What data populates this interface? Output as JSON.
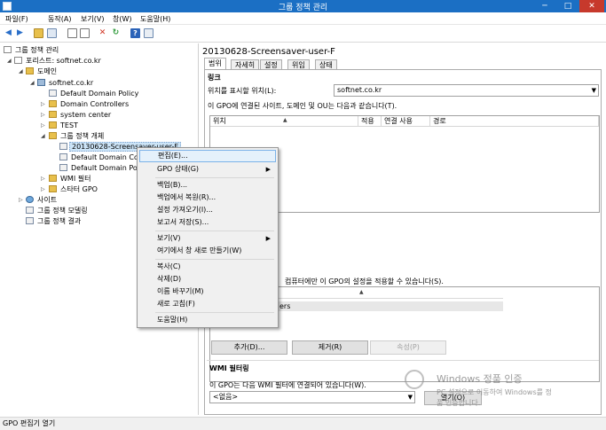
{
  "window": {
    "title": "그룹 정책 관리",
    "minimize": "─",
    "maximize": "□",
    "close": "✕"
  },
  "menu": [
    "파일(F)",
    "동작(A)",
    "보기(V)",
    "창(W)",
    "도움말(H)"
  ],
  "toolbar": {
    "icons": [
      "back-icon",
      "forward-icon",
      "up-icon",
      "show-tree-icon",
      "copy-icon",
      "paste-icon",
      "delete-icon",
      "refresh-icon",
      "help-icon",
      "properties-icon"
    ]
  },
  "tree": {
    "root": "그룹 정책 관리",
    "forest": "포리스트: softnet.co.kr",
    "domains": "도메인",
    "domain": "softnet.co.kr",
    "ddp": "Default Domain Policy",
    "dc": "Domain Controllers",
    "system_center": "system center",
    "test": "TEST",
    "gpo_objects": "그룹 정책 개체",
    "gpo_selected": "20130628-Screensaver-user-F",
    "gpo_dc": "Default Domain Con",
    "gpo_dp": "Default Domain Poli",
    "wmi": "WMI 필터",
    "starter": "스타터 GPO",
    "sites": "사이트",
    "modeling": "그룹 정책 모델링",
    "results": "그룹 정책 결과"
  },
  "right": {
    "title": "20130628-Screensaver-user-F",
    "tabs": [
      "범위",
      "자세히",
      "설정",
      "위임",
      "상태"
    ],
    "links_heading": "링크",
    "links_label": "위치를 표시할 위치(L):",
    "links_value": "softnet.co.kr",
    "links_desc": "이 GPO에 연결된 사이트, 도메인 및 OU는 다음과 같습니다(T).",
    "links_columns": [
      "위치",
      "적용",
      "연결 사용",
      "경로"
    ],
    "filter_desc": "컴퓨터에만 이 GPO의 설정을 적용할 수 있습니다(S).",
    "filter_row": "ers",
    "buttons": {
      "add": "추가(D)...",
      "remove": "제거(R)",
      "properties": "속성(P)"
    },
    "wmi_heading": "WMI 필터링",
    "wmi_desc": "이 GPO는 다음 WMI 필터에 연결되어 있습니다(W).",
    "wmi_value": "<없음>",
    "wmi_open": "열기(O)"
  },
  "context_menu": {
    "items": [
      "편집(E)...",
      "GPO 상태(G)",
      "백업(B)...",
      "백업에서 복원(R)...",
      "설정 가져오기(I)...",
      "보고서 저장(S)...",
      "보기(V)",
      "여기에서 창 새로 만들기(W)",
      "복사(C)",
      "삭제(D)",
      "이름 바꾸기(M)",
      "새로 고침(F)",
      "도움말(H)"
    ]
  },
  "status": "GPO 편집기 열기",
  "watermark": {
    "line1": "Windows 정품 인증",
    "line2": "PC 설정으로 이동하여 Windows를 정",
    "line3": "품 인증합니다."
  },
  "colors": {
    "titlebar": "#1b6fc4",
    "close_button": "#c7392c",
    "highlight": "#e5f1fb"
  }
}
